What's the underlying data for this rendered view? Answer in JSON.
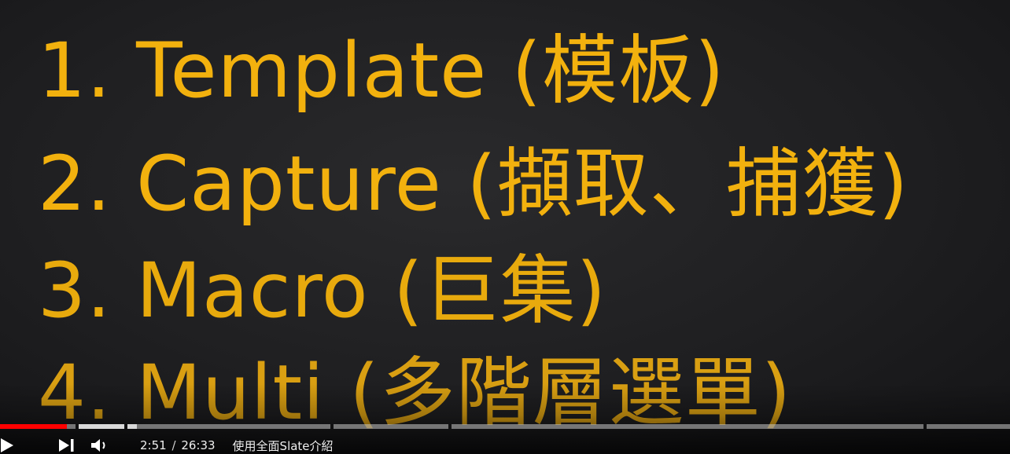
{
  "slide": {
    "lines": [
      "1. Template (模板)",
      "2. Capture (擷取、捕獲)",
      "3. Macro (巨集)",
      "4. Multi (多階層選單)"
    ],
    "text_color": "#f2b10e",
    "background_color": "#1f1f21"
  },
  "player": {
    "progress_fraction": 0.066,
    "played_color": "#ff0000",
    "current_time": "2:51",
    "separator": "/",
    "duration": "26:33",
    "chapter_title": "使用全面Slate介紹",
    "icons": {
      "play": "play-icon",
      "next": "next-icon",
      "volume": "volume-icon"
    }
  }
}
